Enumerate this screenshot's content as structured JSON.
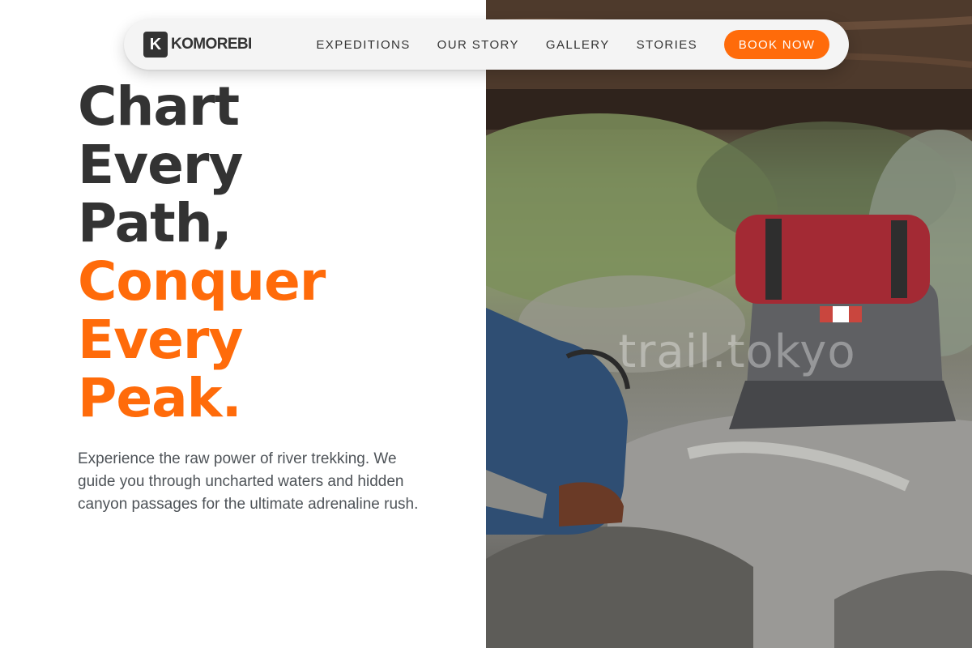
{
  "brand": {
    "logo_letter": "K",
    "name": "KOMOREBI"
  },
  "nav": {
    "links": [
      "EXPEDITIONS",
      "OUR STORY",
      "GALLERY",
      "STORIES"
    ],
    "cta_label": "BOOK NOW"
  },
  "hero": {
    "lines_dark": [
      "Chart",
      "Every",
      "Path,"
    ],
    "lines_accent": [
      "Conquer",
      "Every",
      "Peak."
    ],
    "description": "Experience the raw power of river trekking. We guide you through uncharted waters and hidden canyon passages for the ultimate adrenaline rush."
  },
  "photo": {
    "watermark": "trail.tokyo"
  },
  "colors": {
    "accent": "#ff6b0a",
    "text_dark": "#333333",
    "body_text": "#4e5358",
    "nav_bg": "#f4f4f4"
  }
}
